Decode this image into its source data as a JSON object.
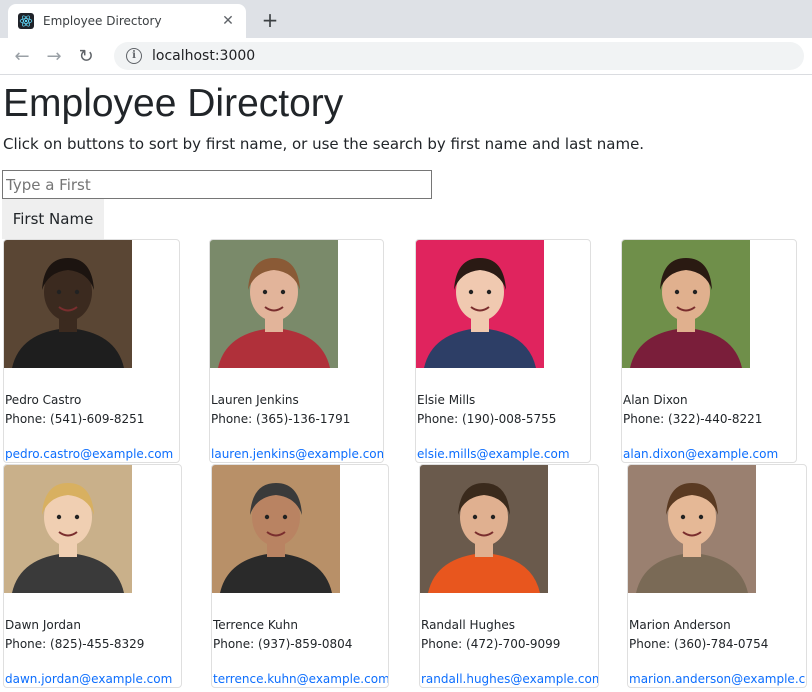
{
  "browser": {
    "tab_title": "Employee Directory",
    "close_glyph": "✕",
    "new_tab_glyph": "+",
    "url": "localhost:3000",
    "back_glyph": "←",
    "forward_glyph": "→",
    "reload_glyph": "↻",
    "info_glyph": "i"
  },
  "page": {
    "title": "Employee Directory",
    "intro": "Click on buttons to sort by first name, or use the search by first name and last name.",
    "search_placeholder": "Type a First",
    "search_value": "",
    "sort_button_label": "First Name"
  },
  "employees": [
    {
      "name": "Pedro Castro",
      "phone": "Phone: (541)-609-8251",
      "email": "pedro.castro@example.com",
      "bg": "#5a4634",
      "skin": "#3b2a1f",
      "hair": "#1c1410",
      "shirt": "#1e1e1e"
    },
    {
      "name": "Lauren Jenkins",
      "phone": "Phone: (365)-136-1791",
      "email": "lauren.jenkins@example.com",
      "bg": "#7a8a6a",
      "skin": "#e2b49a",
      "hair": "#8a5a36",
      "shirt": "#b0303a"
    },
    {
      "name": "Elsie Mills",
      "phone": "Phone: (190)-008-5755",
      "email": "elsie.mills@example.com",
      "bg": "#e0245e",
      "skin": "#f0c9b0",
      "hair": "#2a1a14",
      "shirt": "#2d3e66"
    },
    {
      "name": "Alan Dixon",
      "phone": "Phone: (322)-440-8221",
      "email": "alan.dixon@example.com",
      "bg": "#6f8f4a",
      "skin": "#e0b08e",
      "hair": "#2a1a12",
      "shirt": "#7a1e3a"
    },
    {
      "name": "Dawn Jordan",
      "phone": "Phone: (825)-455-8329",
      "email": "dawn.jordan@example.com",
      "bg": "#c9b08a",
      "skin": "#f0cfb2",
      "hair": "#d8b060",
      "shirt": "#3a3a3a"
    },
    {
      "name": "Terrence Kuhn",
      "phone": "Phone: (937)-859-0804",
      "email": "terrence.kuhn@example.com",
      "bg": "#b89068",
      "skin": "#b98362",
      "hair": "#3a3a3a",
      "shirt": "#2a2a2a"
    },
    {
      "name": "Randall Hughes",
      "phone": "Phone: (472)-700-9099",
      "email": "randall.hughes@example.com",
      "bg": "#6a5a4c",
      "skin": "#e0b090",
      "hair": "#3a2a1c",
      "shirt": "#e8561e"
    },
    {
      "name": "Marion Anderson",
      "phone": "Phone: (360)-784-0754",
      "email": "marion.anderson@example.com",
      "bg": "#9a8070",
      "skin": "#e5b896",
      "hair": "#5a3a22",
      "shirt": "#7a6a56"
    }
  ]
}
